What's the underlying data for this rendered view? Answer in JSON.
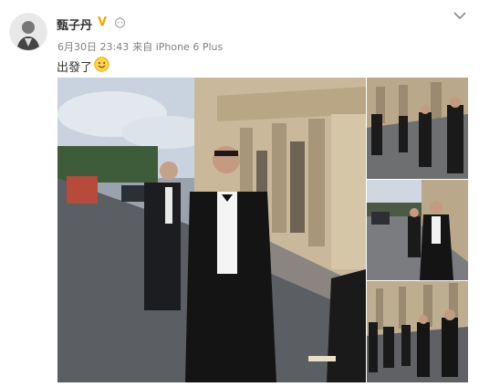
{
  "post": {
    "username": "甄子丹",
    "verified_mark": "V",
    "timestamp": "6月30日 23:43",
    "source": "来自 iPhone 6 Plus",
    "text": "出發了",
    "emoji": "smile-emoji"
  },
  "colors": {
    "verified": "#f2a900",
    "meta_text": "#808080",
    "body_text": "#333333"
  },
  "photos": {
    "count": 4
  }
}
